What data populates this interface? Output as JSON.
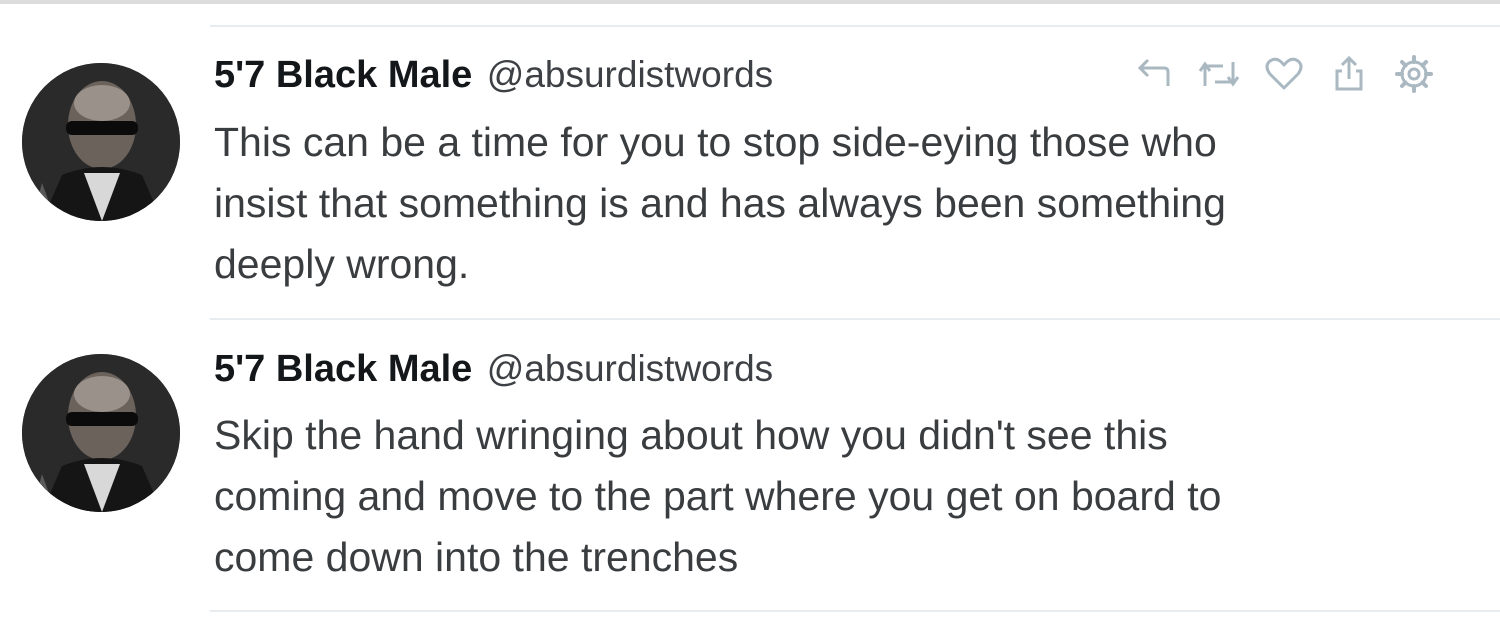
{
  "tweets": [
    {
      "display_name": "5'7 Black Male",
      "handle": "@absurdistwords",
      "text_lines": [
        "This can be a time for you to stop side-eying those who",
        "insist that something is and has always been something",
        "deeply wrong."
      ],
      "actions": [
        "reply-icon",
        "retweet-icon",
        "like-icon",
        "share-icon",
        "settings-icon"
      ]
    },
    {
      "display_name": "5'7 Black Male",
      "handle": "@absurdistwords",
      "text_lines": [
        "Skip the hand wringing about how you didn't see this",
        "coming and move to the part where you get on board to",
        "come down into the trenches"
      ]
    }
  ],
  "colors": {
    "text_primary": "#14171a",
    "text_body": "#3a3d40",
    "icon": "#aab8c2",
    "divider": "#e6ecf0"
  }
}
